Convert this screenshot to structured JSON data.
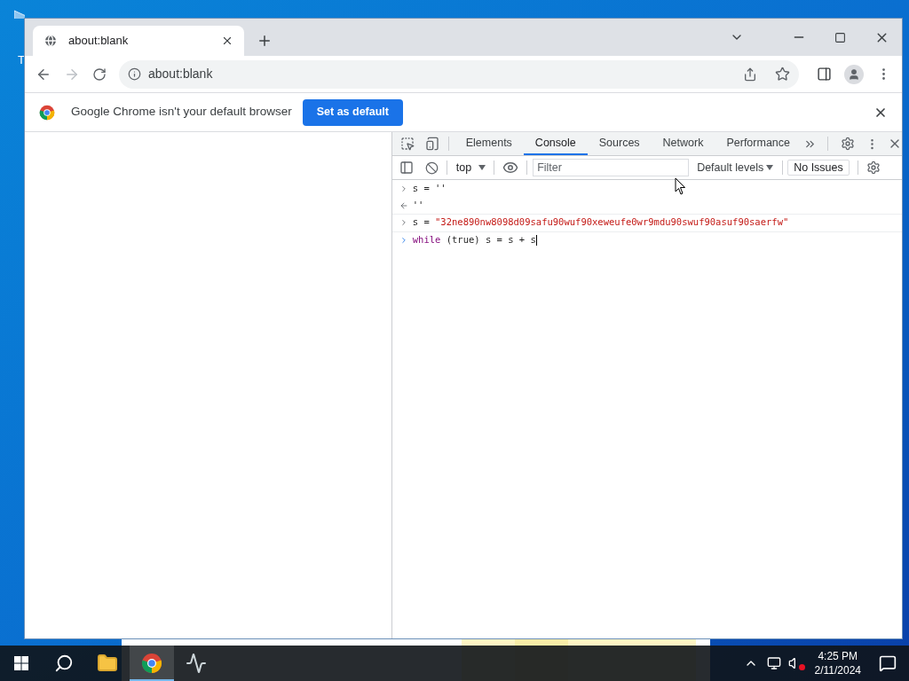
{
  "desktop": {
    "icon_label": "T"
  },
  "browser": {
    "tabs": [
      {
        "title": "about:blank",
        "selected": true
      }
    ],
    "address": "about:blank",
    "infobar": {
      "message": "Google Chrome isn't your default browser",
      "button": "Set as default"
    },
    "devtools": {
      "tabs": [
        {
          "label": "Elements",
          "selected": false
        },
        {
          "label": "Console",
          "selected": true
        },
        {
          "label": "Sources",
          "selected": false
        },
        {
          "label": "Network",
          "selected": false
        },
        {
          "label": "Performance",
          "selected": false
        }
      ],
      "context": "top",
      "filter_placeholder": "Filter",
      "levels": "Default levels",
      "issues": "No Issues",
      "console": [
        {
          "kind": "input",
          "parts": [
            {
              "kind": "plain",
              "text": "s = ''"
            }
          ]
        },
        {
          "kind": "output",
          "parts": [
            {
              "kind": "plain",
              "text": "''"
            }
          ]
        },
        {
          "kind": "input",
          "parts": [
            {
              "kind": "plain",
              "text": "s = "
            },
            {
              "kind": "string",
              "text": "\"32ne890nw8098d09safu90wuf90xeweufe0wr9mdu90swuf90asuf90saerfw\""
            }
          ]
        },
        {
          "kind": "prompt",
          "parts": [
            {
              "kind": "keyword",
              "text": "while"
            },
            {
              "kind": "plain",
              "text": " (true) s = s + s"
            }
          ]
        }
      ]
    }
  },
  "taskbar": {
    "apps": [
      {
        "kind": "explorer",
        "active": false
      },
      {
        "kind": "chrome",
        "active": true
      },
      {
        "kind": "monitor",
        "active": false
      }
    ],
    "time": "4:25 PM",
    "date": "2/11/2024"
  }
}
